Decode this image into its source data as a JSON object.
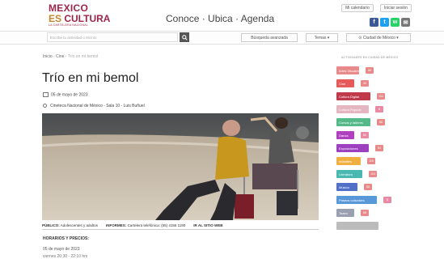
{
  "logo": {
    "line1": "MEXICO",
    "line2_a": "ES",
    "line2_b": " CULTURA",
    "line3": "LA CARTELERA NACIONAL"
  },
  "header": {
    "tagline_1": "Conoce",
    "sep1": " · ",
    "tagline_2": "Ubica",
    "sep2": " · ",
    "tagline_3": "Agenda",
    "calendar_link": "Mi calendario",
    "login_link": "Iniciar sesión",
    "social": {
      "fb": "f",
      "tw": "t",
      "wa": "w",
      "mail": "✉"
    }
  },
  "search": {
    "placeholder": "Escribe tu actividad o recinto",
    "button_icon": "search-icon",
    "advanced": "Búsqueda avanzada",
    "topics": "Temas",
    "city": "Ciudad de México"
  },
  "breadcrumb": {
    "home": "Inicio",
    "sep": " · ",
    "section": "Cine",
    "current": "Trío en mi bemol"
  },
  "event": {
    "title": "Trío en mi bemol",
    "date": "05 de mayo de 2023",
    "venue": "Cineteca Nacional de México - Sala 10 - Luis Buñuel",
    "public_label": "PÚBLICO:",
    "public_value": "Adolescentes y adultos",
    "info_label": "INFORMES:",
    "info_value": "Cartelera telefónica: (55) 4155 1190",
    "site_link": "IR AL SITIO WEB",
    "hours_heading": "HORARIOS Y PRECIOS:",
    "hours_date": "05 de mayo de 2023",
    "hours_time": "viernes 20:30 - 22:10 hrs"
  },
  "sidebar": {
    "title": "ACTIVIDADES EN CIUDAD DE MÉXICO",
    "categories": [
      {
        "label": "Artes Visuales",
        "count": "86",
        "color": "#e98a8a",
        "countColor": "#e98a8a"
      },
      {
        "label": "Cine",
        "count": "40",
        "color": "#e65a5a",
        "countColor": "#e98a8a"
      },
      {
        "label": "Cultura Digital",
        "count": "134",
        "color": "#c0394b",
        "countColor": "#e98a8a"
      },
      {
        "label": "Cultura Popular",
        "count": "8",
        "color": "#e5b6c2",
        "countColor": "#e98aa5"
      },
      {
        "label": "Cursos y talleres",
        "count": "86",
        "color": "#55b98a",
        "countColor": "#e98a8a"
      },
      {
        "label": "Danza",
        "count": "84",
        "color": "#b040c0",
        "countColor": "#e98aa5"
      },
      {
        "label": "Exposiciones",
        "count": "84",
        "color": "#9c40c0",
        "countColor": "#e98a8a"
      },
      {
        "label": "Infantiles",
        "count": "115",
        "color": "#f0b040",
        "countColor": "#e98a8a"
      },
      {
        "label": "Literatura",
        "count": "124",
        "color": "#48b8b0",
        "countColor": "#e98a8a"
      },
      {
        "label": "Música",
        "count": "88",
        "color": "#5070c8",
        "countColor": "#e98a8a"
      },
      {
        "label": "Paseos culturales",
        "count": "8",
        "color": "#5898d8",
        "countColor": "#e98aa5"
      },
      {
        "label": "Teatro",
        "count": "88",
        "color": "#9aa0b0",
        "countColor": "#e98a8a"
      },
      {
        "label": "",
        "count": "",
        "color": "#bcbcbc",
        "countColor": "#e98a8a"
      }
    ]
  },
  "colors": {
    "brand": "#9d2449",
    "gold": "#c0872c"
  }
}
